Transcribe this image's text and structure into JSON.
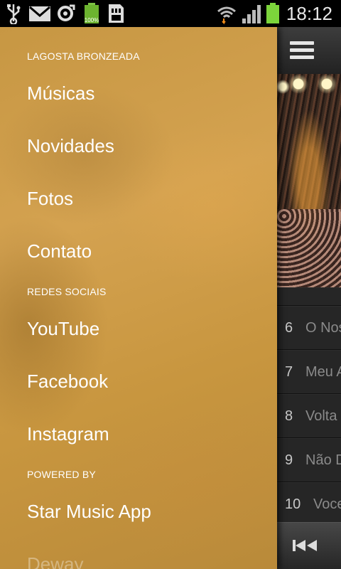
{
  "status_bar": {
    "time": "18:12",
    "battery_percent_label": "100%",
    "icons": [
      "usb-icon",
      "gmail-icon",
      "sync-icon",
      "battery-full-icon",
      "sd-card-icon",
      "wifi-icon",
      "signal-icon",
      "battery-icon"
    ]
  },
  "drawer": {
    "sections": [
      {
        "title": "LAGOSTA BRONZEADA",
        "items": [
          "Músicas",
          "Novidades",
          "Fotos",
          "Contato"
        ]
      },
      {
        "title": "REDES SOCIAIS",
        "items": [
          "YouTube",
          "Facebook",
          "Instagram"
        ]
      },
      {
        "title": "POWERED BY",
        "items": [
          "Star Music App",
          "Deway"
        ]
      }
    ]
  },
  "app": {
    "menu_icon": "hamburger-menu-icon",
    "tracks": [
      {
        "number": "6",
        "title": "O Nos"
      },
      {
        "number": "7",
        "title": "Meu A"
      },
      {
        "number": "8",
        "title": "Volta"
      },
      {
        "number": "9",
        "title": "Não D"
      },
      {
        "number": "10",
        "title": "Voce"
      }
    ],
    "player_icon": "previous-track-icon"
  },
  "colors": {
    "drawer_gold": "#c99a45",
    "toolbar_dark": "#2e2e2e",
    "text_white": "#ffffff"
  }
}
